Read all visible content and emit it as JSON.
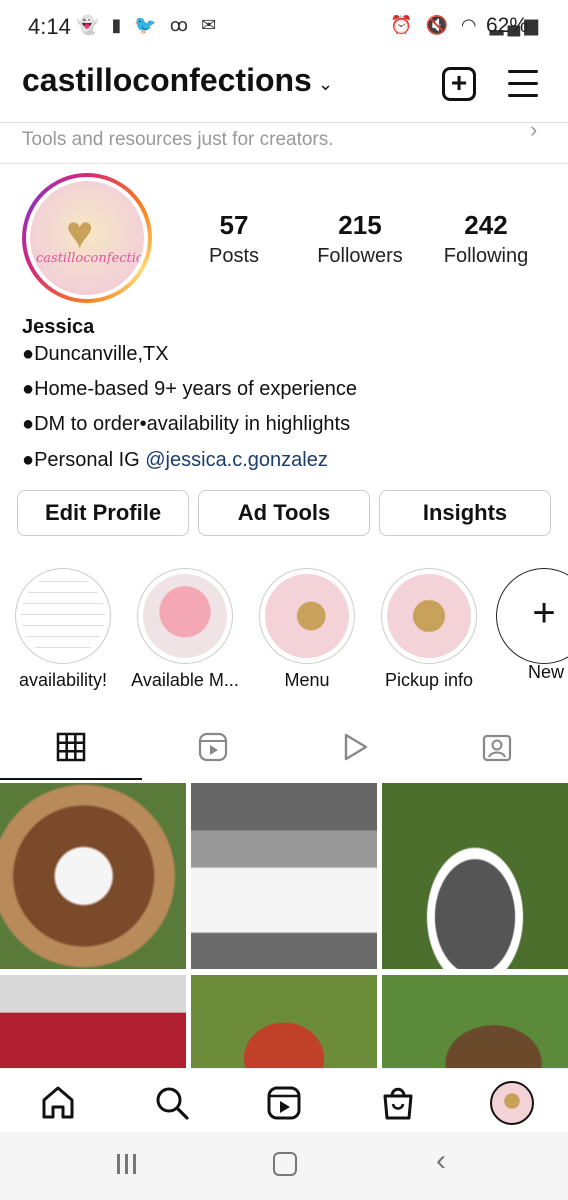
{
  "status_bar": {
    "time": "4:14",
    "battery": "62%",
    "left_icons": [
      "snapchat-icon",
      "sd-card-icon",
      "twitter-icon",
      "voicemail-icon",
      "email-icon"
    ],
    "right_icons": [
      "alarm-icon",
      "mute-icon",
      "wifi-icon",
      "signal-icon"
    ]
  },
  "header": {
    "username": "castilloconfections"
  },
  "banner": {
    "text": "Tools and resources just for creators."
  },
  "profile": {
    "avatar_text": "castilloconfections",
    "stats": [
      {
        "number": "57",
        "label": "Posts"
      },
      {
        "number": "215",
        "label": "Followers"
      },
      {
        "number": "242",
        "label": "Following"
      }
    ],
    "name": "Jessica",
    "bio_lines": [
      "●Duncanville,TX",
      "●Home-based 9+ years of experience",
      "●DM to order•availability in highlights"
    ],
    "bio_personal_prefix": "●Personal IG ",
    "bio_mention": "@jessica.c.gonzalez"
  },
  "buttons": {
    "edit_profile": "Edit Profile",
    "ad_tools": "Ad Tools",
    "insights": "Insights"
  },
  "highlights": [
    {
      "label": "availability!"
    },
    {
      "label": "Available M..."
    },
    {
      "label": "Menu"
    },
    {
      "label": "Pickup info"
    },
    {
      "label": "New"
    }
  ],
  "tabs": [
    "grid-icon",
    "reels-icon",
    "play-icon",
    "tagged-icon"
  ],
  "bottom_nav": [
    "home-icon",
    "search-icon",
    "reels-icon",
    "shop-icon",
    "profile-avatar"
  ],
  "colors": {
    "mention": "#1a3c6e",
    "ring": "#d62976"
  }
}
